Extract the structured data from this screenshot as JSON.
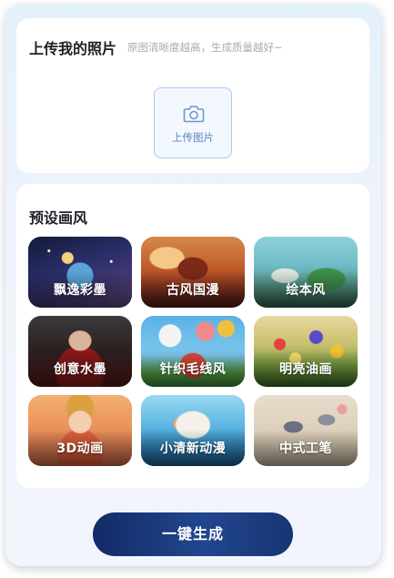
{
  "upload": {
    "title": "上传我的照片",
    "hint": "原图清晰度越高，生成质量越好~",
    "button_label": "上传图片",
    "icon": "camera-icon"
  },
  "styles": {
    "title": "预设画风",
    "items": [
      {
        "label": "飘逸彩墨"
      },
      {
        "label": "古风国漫"
      },
      {
        "label": "绘本风"
      },
      {
        "label": "创意水墨"
      },
      {
        "label": "针织毛线风"
      },
      {
        "label": "明亮油画"
      },
      {
        "label": "3D动画"
      },
      {
        "label": "小清新动漫"
      },
      {
        "label": "中式工笔"
      }
    ]
  },
  "actions": {
    "generate_label": "一键生成"
  },
  "colors": {
    "accent": "#1c3a80",
    "upload_border": "#a9c9ee",
    "hint": "#a7abb3"
  }
}
